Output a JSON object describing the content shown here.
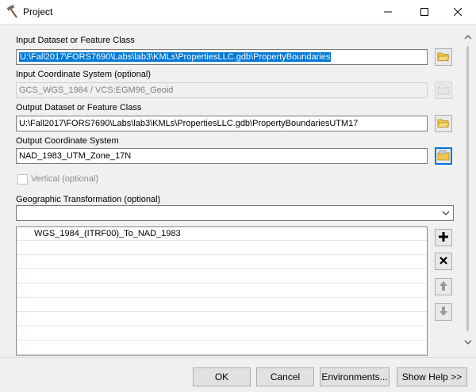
{
  "window": {
    "title": "Project",
    "app_icon": "hammer-icon"
  },
  "form": {
    "input_dataset": {
      "label": "Input Dataset or Feature Class",
      "value": "U:\\Fall2017\\FORS7690\\Labs\\lab3\\KMLs\\PropertiesLLC.gdb\\PropertyBoundaries"
    },
    "input_coord_system": {
      "label": "Input Coordinate System (optional)",
      "value": "GCS_WGS_1984 / VCS:EGM96_Geoid"
    },
    "output_dataset": {
      "label": "Output Dataset or Feature Class",
      "value": "U:\\Fall2017\\FORS7690\\Labs\\lab3\\KMLs\\PropertiesLLC.gdb\\PropertyBoundariesUTM17"
    },
    "output_coord_system": {
      "label": "Output Coordinate System",
      "value": "NAD_1983_UTM_Zone_17N"
    },
    "vertical": {
      "label": "Vertical (optional)",
      "checked": false
    },
    "geo_transformation": {
      "label": "Geographic Transformation (optional)",
      "dropdown_value": "",
      "items": [
        "WGS_1984_(ITRF00)_To_NAD_1983"
      ]
    }
  },
  "buttons": {
    "ok": "OK",
    "cancel": "Cancel",
    "environments": "Environments...",
    "show_help": "Show Help >>"
  },
  "colors": {
    "selection": "#0078d7",
    "folder": "#f2c84b",
    "focus": "#0078d7"
  }
}
